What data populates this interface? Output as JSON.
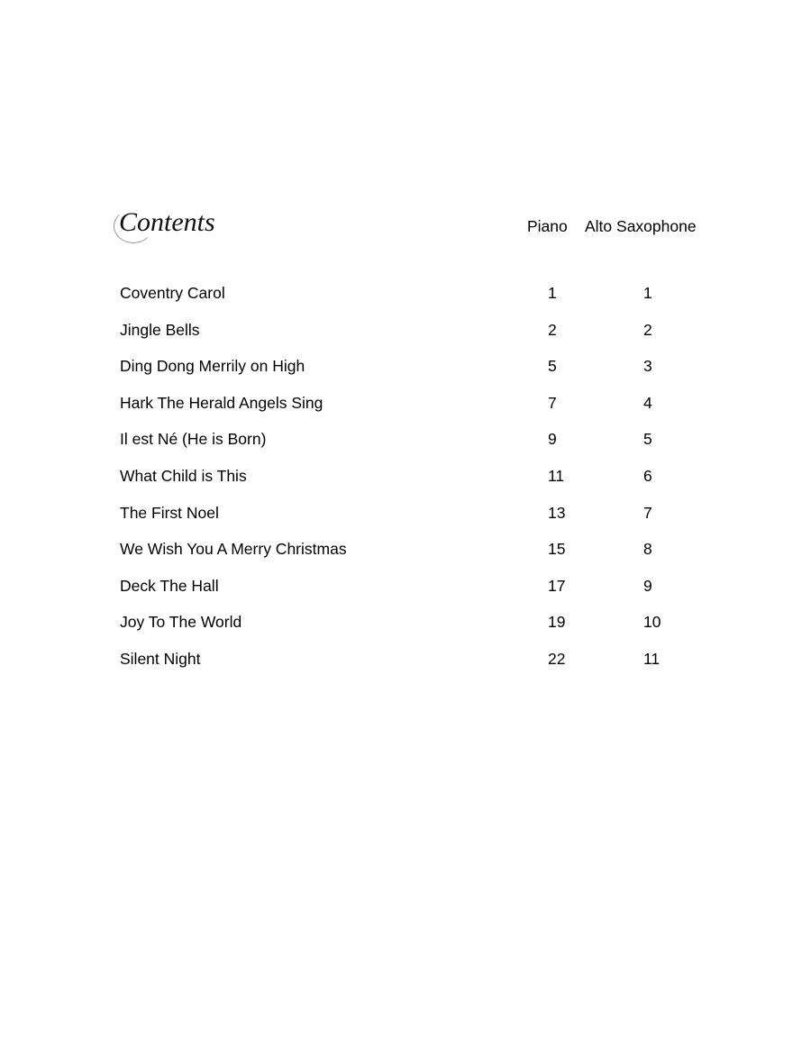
{
  "document": {
    "title": "Contents",
    "columns": [
      "Piano",
      "Alto Saxophone"
    ],
    "entries": [
      {
        "title": "Coventry Carol",
        "piano": "1",
        "sax": "1"
      },
      {
        "title": "Jingle Bells",
        "piano": "2",
        "sax": "2"
      },
      {
        "title": "Ding Dong Merrily on High",
        "piano": "5",
        "sax": "3"
      },
      {
        "title": "Hark The Herald Angels Sing",
        "piano": "7",
        "sax": "4"
      },
      {
        "title": "Il est Né (He is Born)",
        "piano": "9",
        "sax": "5"
      },
      {
        "title": "What Child is This",
        "piano": "11",
        "sax": "6"
      },
      {
        "title": "The First Noel",
        "piano": "13",
        "sax": "7"
      },
      {
        "title": "We Wish You A Merry Christmas",
        "piano": "15",
        "sax": "8"
      },
      {
        "title": "Deck The Hall",
        "piano": "17",
        "sax": "9"
      },
      {
        "title": "Joy To The World",
        "piano": "19",
        "sax": "10"
      },
      {
        "title": "Silent Night",
        "piano": "22",
        "sax": "11"
      }
    ]
  }
}
